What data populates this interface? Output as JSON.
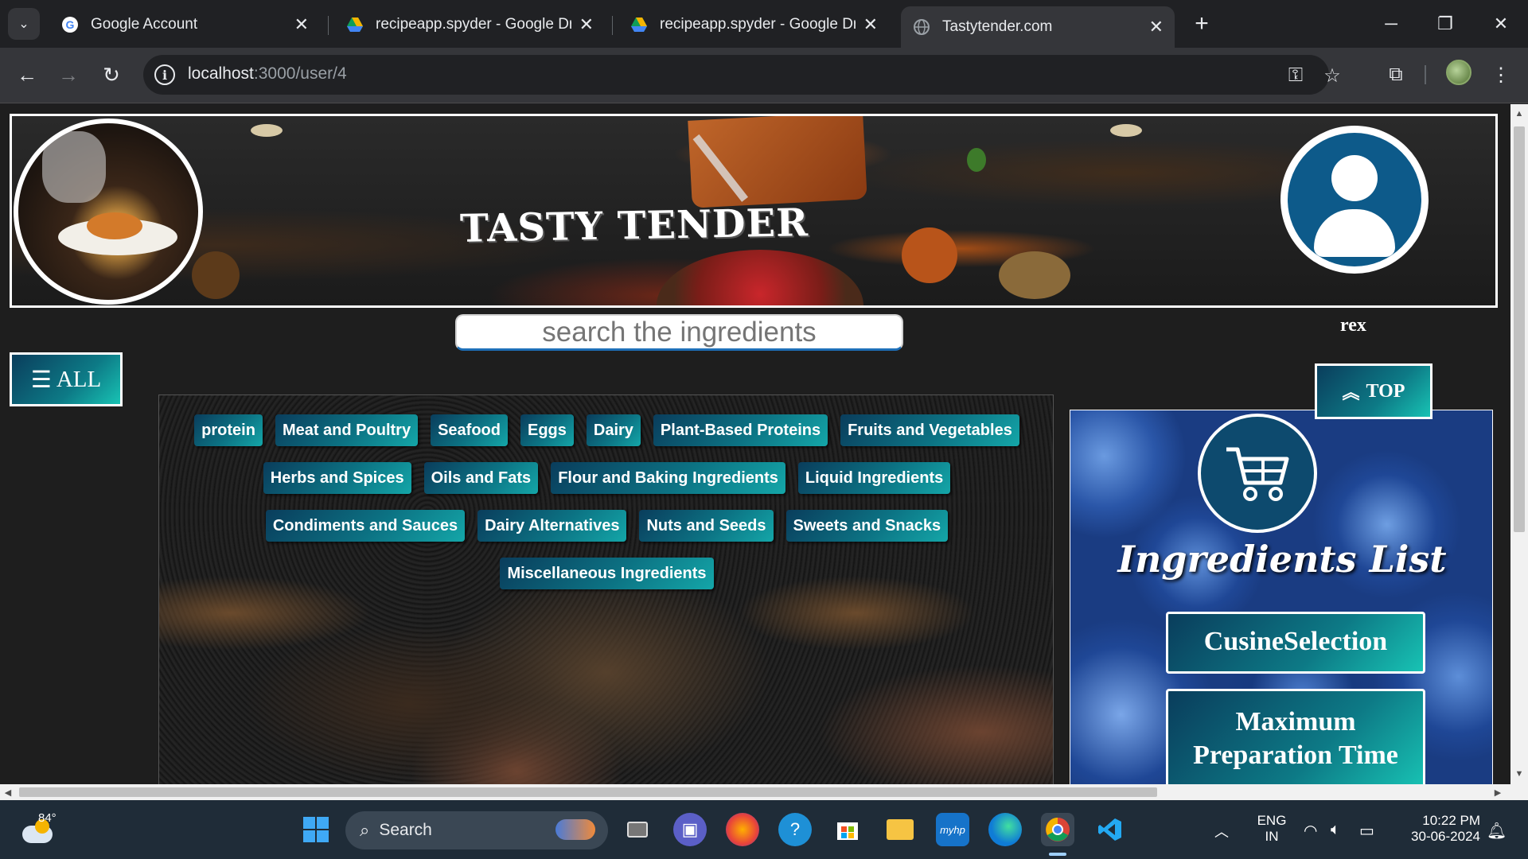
{
  "browser": {
    "tabs": [
      {
        "title": "Google Account",
        "favicon": "google-icon",
        "active": false
      },
      {
        "title": "recipeapp.spyder - Google Drive",
        "favicon": "drive-icon",
        "active": false
      },
      {
        "title": "recipeapp.spyder - Google Drive",
        "favicon": "drive-icon",
        "active": false
      },
      {
        "title": "Tastytender.com",
        "favicon": "globe-icon",
        "active": true
      }
    ],
    "url_host": "localhost",
    "url_path": ":3000/user/4"
  },
  "site": {
    "logo_text": "TASTY TENDER",
    "search_placeholder": "search the ingredients",
    "username": "rex",
    "all_button": "ALL",
    "top_button": "TOP",
    "categories": [
      [
        "protein",
        "Meat and Poultry",
        "Seafood",
        "Eggs",
        "Dairy",
        "Plant-Based Proteins",
        "Fruits and Vegetables"
      ],
      [
        "Herbs and Spices",
        "Oils and Fats",
        "Flour and Baking Ingredients",
        "Liquid Ingredients"
      ],
      [
        "Condiments and Sauces",
        "Dairy Alternatives",
        "Nuts and Seeds",
        "Sweets and Snacks"
      ],
      [
        "Miscellaneous Ingredients"
      ]
    ],
    "side_title": "Ingredients List",
    "side_buttons": [
      "CusineSelection",
      "Maximum Preparation Time"
    ]
  },
  "taskbar": {
    "weather_temp": "84°",
    "search_label": "Search",
    "lang_top": "ENG",
    "lang_bottom": "IN",
    "time": "10:22 PM",
    "date": "30-06-2024"
  },
  "colors": {
    "accent_teal": "#0c7283",
    "accent_navy": "#0a3d5c",
    "page_bg": "#1e1e1e"
  }
}
